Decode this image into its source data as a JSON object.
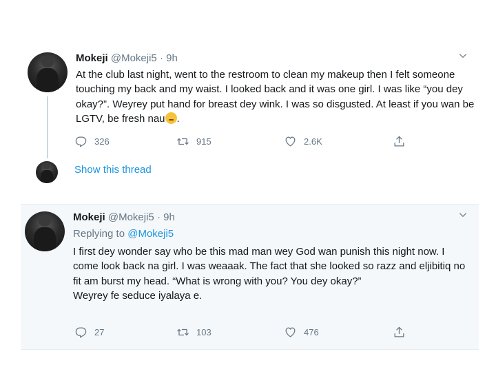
{
  "tweet1": {
    "name": "Mokeji",
    "handle": "@Mokeji5",
    "separator": "·",
    "time": "9h",
    "text": "At the club last night, went to the restroom to clean my makeup then I felt someone touching my back and my waist. I looked back and it was one girl. I was like “you dey okay?”. Weyrey put hand for breast dey wink. I was so disgusted. At least if you wan be LGTV, be fresh nau",
    "text_end": ".",
    "replies": "326",
    "retweets": "915",
    "likes": "2.6K"
  },
  "thread": {
    "label": "Show this thread"
  },
  "tweet2": {
    "name": "Mokeji",
    "handle": "@Mokeji5",
    "separator": "·",
    "time": "9h",
    "replying_prefix": "Replying to",
    "replying_handle": "@Mokeji5",
    "paragraph1": "I first dey wonder say who be this mad man wey God wan punish this night now. I come look back na girl. I was weaaak. The fact that she looked so razz and eljibitiq no fit am burst my head. “What is wrong with you? You dey okay?”",
    "paragraph2": "Weyrey fe seduce iyalaya e.",
    "replies": "27",
    "retweets": "103",
    "likes": "476"
  },
  "icons": {
    "reply": "reply-icon",
    "retweet": "retweet-icon",
    "like": "heart-icon",
    "share": "share-icon",
    "more": "chevron-down-icon",
    "emoji": "emoji-icon"
  },
  "colors": {
    "link": "#1b95e0",
    "muted": "#657786",
    "reply_background": "#f5f8fa"
  }
}
